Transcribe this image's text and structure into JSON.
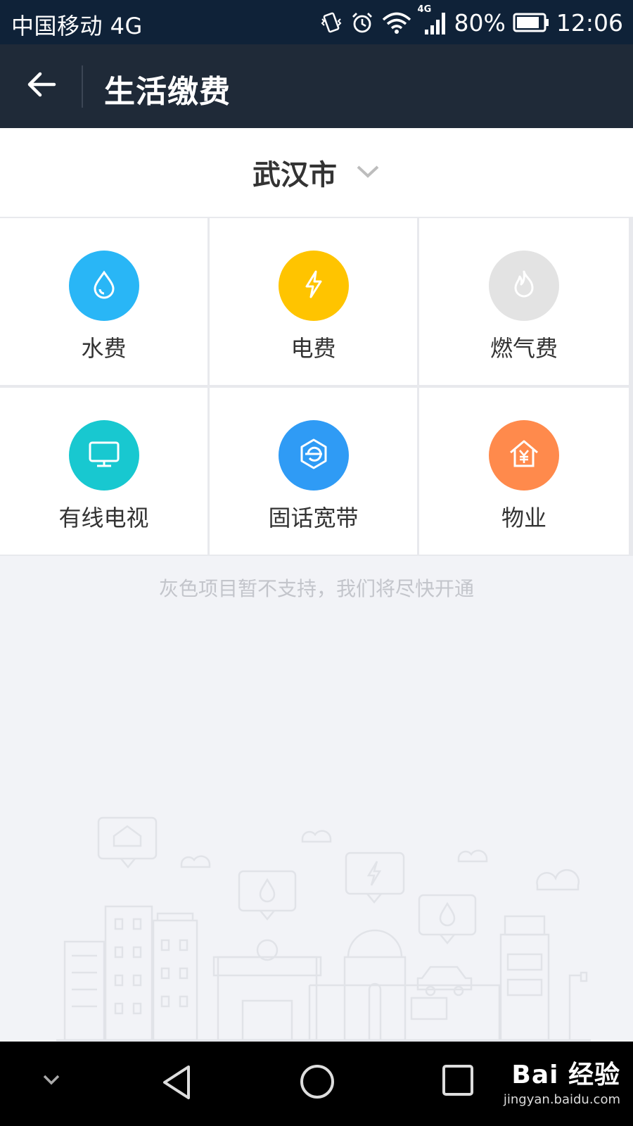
{
  "status": {
    "carrier": "中国移动 4G",
    "net_small": "4G",
    "battery": "80%",
    "time": "12:06",
    "icons": [
      "vibrate-icon",
      "alarm-icon",
      "wifi-icon",
      "signal-icon",
      "battery-icon"
    ]
  },
  "appbar": {
    "title": "生活缴费",
    "back_icon": "arrow-left-icon"
  },
  "city": {
    "name": "武汉市",
    "icon": "chevron-down-icon"
  },
  "services": [
    {
      "label": "水费",
      "icon": "water-drop-icon",
      "color": "#29b6f6",
      "enabled": true
    },
    {
      "label": "电费",
      "icon": "lightning-icon",
      "color": "#ffc400",
      "enabled": true
    },
    {
      "label": "燃气费",
      "icon": "flame-icon",
      "color": "#e3e3e3",
      "enabled": false
    },
    {
      "label": "有线电视",
      "icon": "tv-icon",
      "color": "#18c8d0",
      "enabled": true
    },
    {
      "label": "固话宽带",
      "icon": "broadband-icon",
      "color": "#2f9bf5",
      "enabled": true
    },
    {
      "label": "物业",
      "icon": "house-yen-icon",
      "color": "#ff8a4c",
      "enabled": true
    }
  ],
  "hint": "灰色项目暂不支持，我们将尽快开通",
  "navbar": {
    "icons": [
      "collapse-icon",
      "back-triangle-icon",
      "home-circle-icon",
      "recents-square-icon"
    ]
  },
  "watermark": {
    "logo": "Bai 经验",
    "url": "jingyan.baidu.com"
  }
}
